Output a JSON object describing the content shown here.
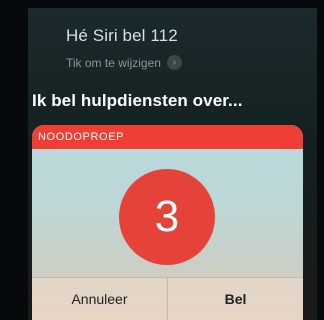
{
  "siri": {
    "query": "Hé Siri bel 112",
    "edit_hint": "Tik om te wijzigen",
    "edit_icon": "chevron-right-icon",
    "response": "Ik bel hulpdiensten over..."
  },
  "emergency_card": {
    "title": "NOODOPROEP",
    "countdown": "3",
    "cancel_label": "Annuleer",
    "call_label": "Bel",
    "accent_color": "#ef3e33"
  }
}
